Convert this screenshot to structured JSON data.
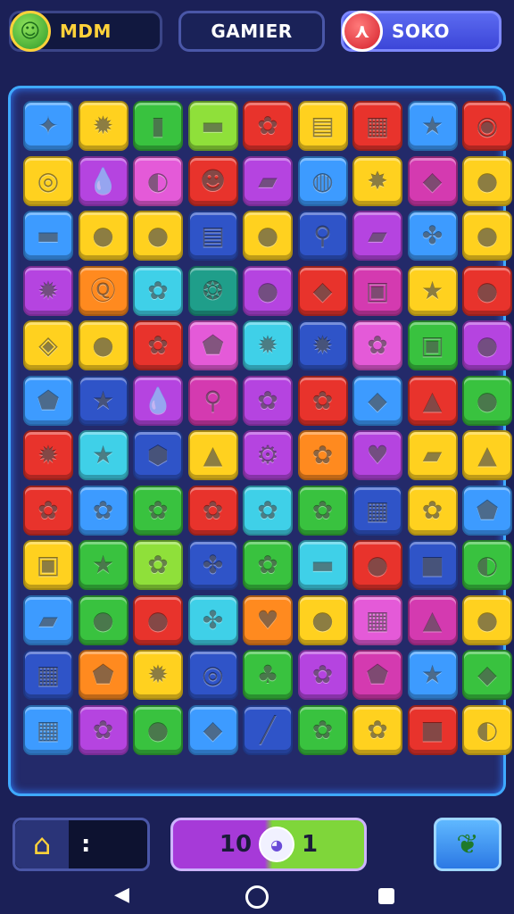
{
  "header": {
    "left_label": "MDM",
    "mid_label": "GAMIER",
    "right_label": "SOKO",
    "left_badge_icon": "frog-icon",
    "right_badge_icon": "red-emblem-icon"
  },
  "footer": {
    "home_icon": "home-icon",
    "home_colon": ":",
    "score_left": "10",
    "score_right": "1",
    "mascot_icon": "bunny-icon",
    "hint_icon": "leaf-icon"
  },
  "palette": {
    "bl": "#3d9bff",
    "ye": "#ffd11f",
    "gr": "#39c23f",
    "lg": "#8fe03a",
    "re": "#e8332c",
    "or": "#ff8a1f",
    "pu": "#b544e0",
    "pk": "#e45ad8",
    "cy": "#3fd0e8",
    "nb": "#2f54c8",
    "tl": "#1f9e8a",
    "ma": "#d43ab0"
  },
  "board": [
    [
      [
        "bl",
        "✦"
      ],
      [
        "ye",
        "✹"
      ],
      [
        "gr",
        "▮"
      ],
      [
        "lg",
        "▬"
      ],
      [
        "re",
        "✿"
      ],
      [
        "ye",
        "▤"
      ],
      [
        "re",
        "▦"
      ],
      [
        "bl",
        "★"
      ],
      [
        "re",
        "◉"
      ]
    ],
    [
      [
        "ye",
        "◎"
      ],
      [
        "pu",
        "💧"
      ],
      [
        "pk",
        "◐"
      ],
      [
        "re",
        "☻"
      ],
      [
        "pu",
        "▰"
      ],
      [
        "bl",
        "◍"
      ],
      [
        "ye",
        "✸"
      ],
      [
        "ma",
        "◆"
      ],
      [
        "ye",
        "●"
      ]
    ],
    [
      [
        "bl",
        "▬"
      ],
      [
        "ye",
        "●"
      ],
      [
        "ye",
        "●"
      ],
      [
        "nb",
        "▤"
      ],
      [
        "ye",
        "●"
      ],
      [
        "nb",
        "⚲"
      ],
      [
        "pu",
        "▰"
      ],
      [
        "bl",
        "✤"
      ],
      [
        "ye",
        "●"
      ]
    ],
    [
      [
        "pu",
        "✹"
      ],
      [
        "or",
        "Ⓠ"
      ],
      [
        "cy",
        "✿"
      ],
      [
        "tl",
        "❂"
      ],
      [
        "pu",
        "●"
      ],
      [
        "re",
        "◆"
      ],
      [
        "ma",
        "▣"
      ],
      [
        "ye",
        "★"
      ],
      [
        "re",
        "●"
      ]
    ],
    [
      [
        "ye",
        "◈"
      ],
      [
        "ye",
        "●"
      ],
      [
        "re",
        "✿"
      ],
      [
        "pk",
        "⬟"
      ],
      [
        "cy",
        "✹"
      ],
      [
        "nb",
        "✹"
      ],
      [
        "pk",
        "✿"
      ],
      [
        "gr",
        "▣"
      ],
      [
        "pu",
        "●"
      ]
    ],
    [
      [
        "bl",
        "⬟"
      ],
      [
        "nb",
        "★"
      ],
      [
        "pu",
        "💧"
      ],
      [
        "ma",
        "⚲"
      ],
      [
        "pu",
        "✿"
      ],
      [
        "re",
        "✿"
      ],
      [
        "bl",
        "◆"
      ],
      [
        "re",
        "▲"
      ],
      [
        "gr",
        "●"
      ]
    ],
    [
      [
        "re",
        "✹"
      ],
      [
        "cy",
        "★"
      ],
      [
        "nb",
        "⬢"
      ],
      [
        "ye",
        "▲"
      ],
      [
        "pu",
        "⚙"
      ],
      [
        "or",
        "✿"
      ],
      [
        "pu",
        "♥"
      ],
      [
        "ye",
        "▰"
      ],
      [
        "ye",
        "▲"
      ]
    ],
    [
      [
        "re",
        "✿"
      ],
      [
        "bl",
        "✿"
      ],
      [
        "gr",
        "✿"
      ],
      [
        "re",
        "✿"
      ],
      [
        "cy",
        "✿"
      ],
      [
        "gr",
        "✿"
      ],
      [
        "nb",
        "▦"
      ],
      [
        "ye",
        "✿"
      ],
      [
        "bl",
        "⬟"
      ]
    ],
    [
      [
        "ye",
        "▣"
      ],
      [
        "gr",
        "★"
      ],
      [
        "lg",
        "✿"
      ],
      [
        "nb",
        "✤"
      ],
      [
        "gr",
        "✿"
      ],
      [
        "cy",
        "▬"
      ],
      [
        "re",
        "●"
      ],
      [
        "nb",
        "■"
      ],
      [
        "gr",
        "◐"
      ]
    ],
    [
      [
        "bl",
        "▰"
      ],
      [
        "gr",
        "●"
      ],
      [
        "re",
        "●"
      ],
      [
        "cy",
        "✤"
      ],
      [
        "or",
        "♥"
      ],
      [
        "ye",
        "●"
      ],
      [
        "pk",
        "▦"
      ],
      [
        "ma",
        "▲"
      ],
      [
        "ye",
        "●"
      ]
    ],
    [
      [
        "nb",
        "▦"
      ],
      [
        "or",
        "⬟"
      ],
      [
        "ye",
        "✹"
      ],
      [
        "nb",
        "◎"
      ],
      [
        "gr",
        "♣"
      ],
      [
        "pu",
        "✿"
      ],
      [
        "ma",
        "⬟"
      ],
      [
        "bl",
        "★"
      ],
      [
        "gr",
        "◆"
      ]
    ],
    [
      [
        "bl",
        "▦"
      ],
      [
        "pu",
        "✿"
      ],
      [
        "gr",
        "●"
      ],
      [
        "bl",
        "◆"
      ],
      [
        "nb",
        "╱"
      ],
      [
        "gr",
        "✿"
      ],
      [
        "ye",
        "✿"
      ],
      [
        "re",
        "■"
      ],
      [
        "ye",
        "◐"
      ]
    ]
  ]
}
